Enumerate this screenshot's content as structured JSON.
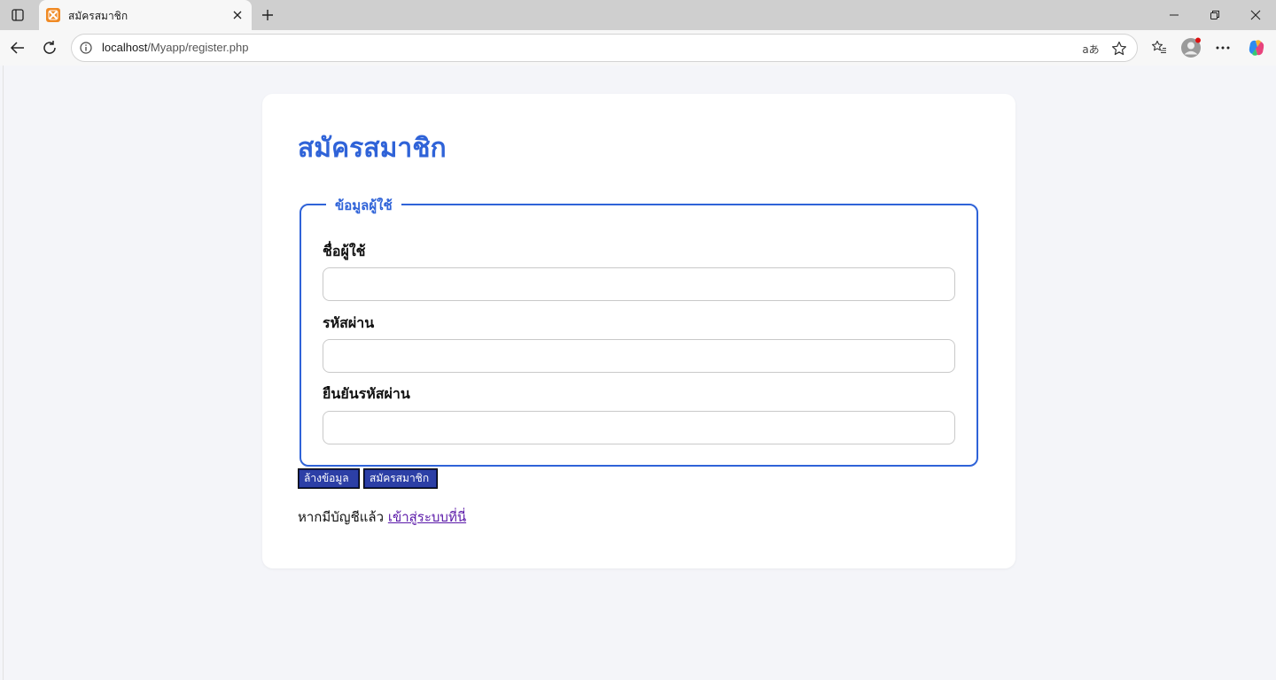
{
  "browser": {
    "tab_title": "สมัครสมาชิก",
    "url_host": "localhost",
    "url_path": "/Myapp/register.php",
    "read_aloud_label": "aあ"
  },
  "page": {
    "title": "สมัครสมาชิก",
    "fieldset_legend": "ข้อมูลผู้ใช้",
    "fields": [
      {
        "label": "ชื่อผู้ใช้",
        "value": "",
        "placeholder": ""
      },
      {
        "label": "รหัสผ่าน",
        "value": "",
        "placeholder": ""
      },
      {
        "label": "ยืนยันรหัสผ่าน",
        "value": "",
        "placeholder": ""
      }
    ],
    "buttons": {
      "clear": "ล้างข้อมูล",
      "submit": "สมัครสมาชิก"
    },
    "login_prompt": "หากมีบัญชีแล้ว",
    "login_link": "เข้าสู่ระบบที่นี่"
  },
  "colors": {
    "accent": "#2f63d8",
    "button_bg": "#2c3fa6",
    "link": "#5a18a8",
    "page_bg": "#f4f5f9"
  }
}
